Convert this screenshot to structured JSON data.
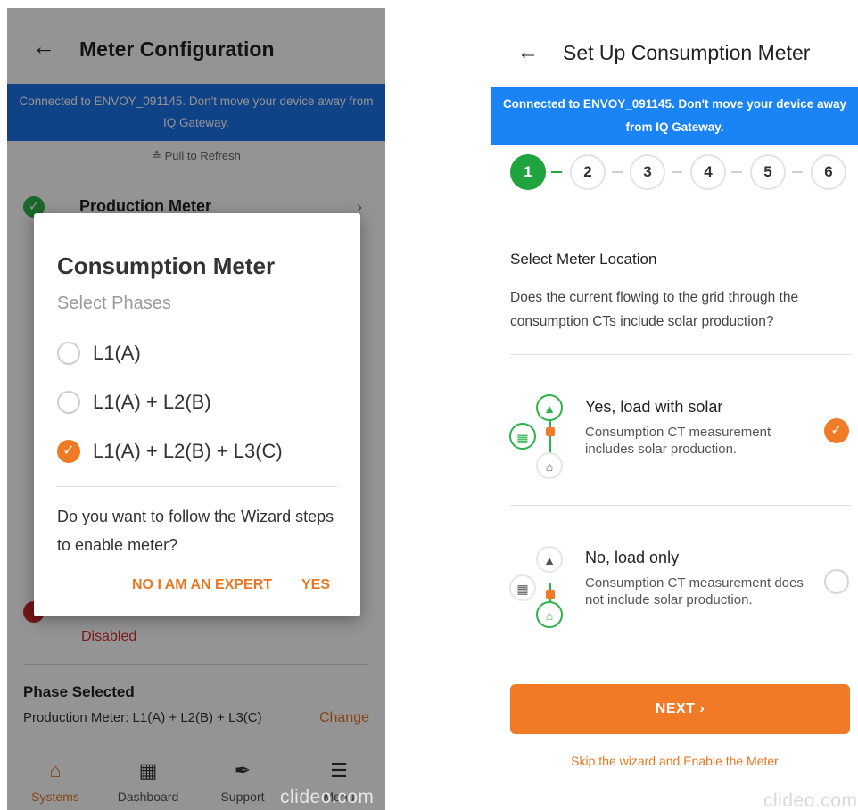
{
  "left": {
    "header": {
      "back_icon": "back-arrow-icon",
      "title": "Meter Configuration"
    },
    "banner": {
      "text": "Connected to ENVOY_091145. Don't move your device away from IQ Gateway."
    },
    "pull_to_refresh": "Pull to Refresh",
    "production_meter": {
      "label": "Production Meter",
      "status_icon": "check-icon"
    },
    "consumption_status": "Disabled",
    "phase": {
      "title": "Phase Selected",
      "value": "Production Meter: L1(A) + L2(B) + L3(C)",
      "change": "Change"
    },
    "nav": [
      {
        "label": "Systems",
        "icon": "home-icon",
        "active": true
      },
      {
        "label": "Dashboard",
        "icon": "dashboard-icon",
        "active": false
      },
      {
        "label": "Support",
        "icon": "wrench-icon",
        "active": false
      },
      {
        "label": "Menu",
        "icon": "menu-icon",
        "active": false
      }
    ],
    "dialog": {
      "title": "Consumption Meter",
      "subtitle": "Select Phases",
      "options": [
        {
          "label": "L1(A)",
          "selected": false
        },
        {
          "label": "L1(A) + L2(B)",
          "selected": false
        },
        {
          "label": "L1(A) + L2(B) + L3(C)",
          "selected": true
        }
      ],
      "question": "Do you want to follow the Wizard steps to enable meter?",
      "btn_expert": "NO I AM AN EXPERT",
      "btn_yes": "YES"
    },
    "watermark": "clideo.com"
  },
  "right": {
    "header": {
      "back_icon": "back-arrow-icon",
      "title": "Set Up Consumption Meter"
    },
    "banner": {
      "text": "Connected to ENVOY_091145. Don't move your device away from IQ Gateway."
    },
    "steps": [
      "1",
      "2",
      "3",
      "4",
      "5",
      "6"
    ],
    "active_step": 1,
    "section_title": "Select Meter Location",
    "question": "Does the current flowing to the grid through the consumption CTs include solar production?",
    "options": [
      {
        "title": "Yes, load with solar",
        "desc": "Consumption CT measurement includes solar production.",
        "selected": true
      },
      {
        "title": "No, load only",
        "desc": "Consumption CT measurement does not include solar production.",
        "selected": false
      }
    ],
    "next_label": "NEXT",
    "skip_label": "Skip the wizard and Enable the Meter",
    "watermark": "clideo.com"
  },
  "colors": {
    "accent": "#f07a26",
    "banner": "#1a83f5",
    "success": "#21a33f",
    "danger": "#d32f2f"
  }
}
